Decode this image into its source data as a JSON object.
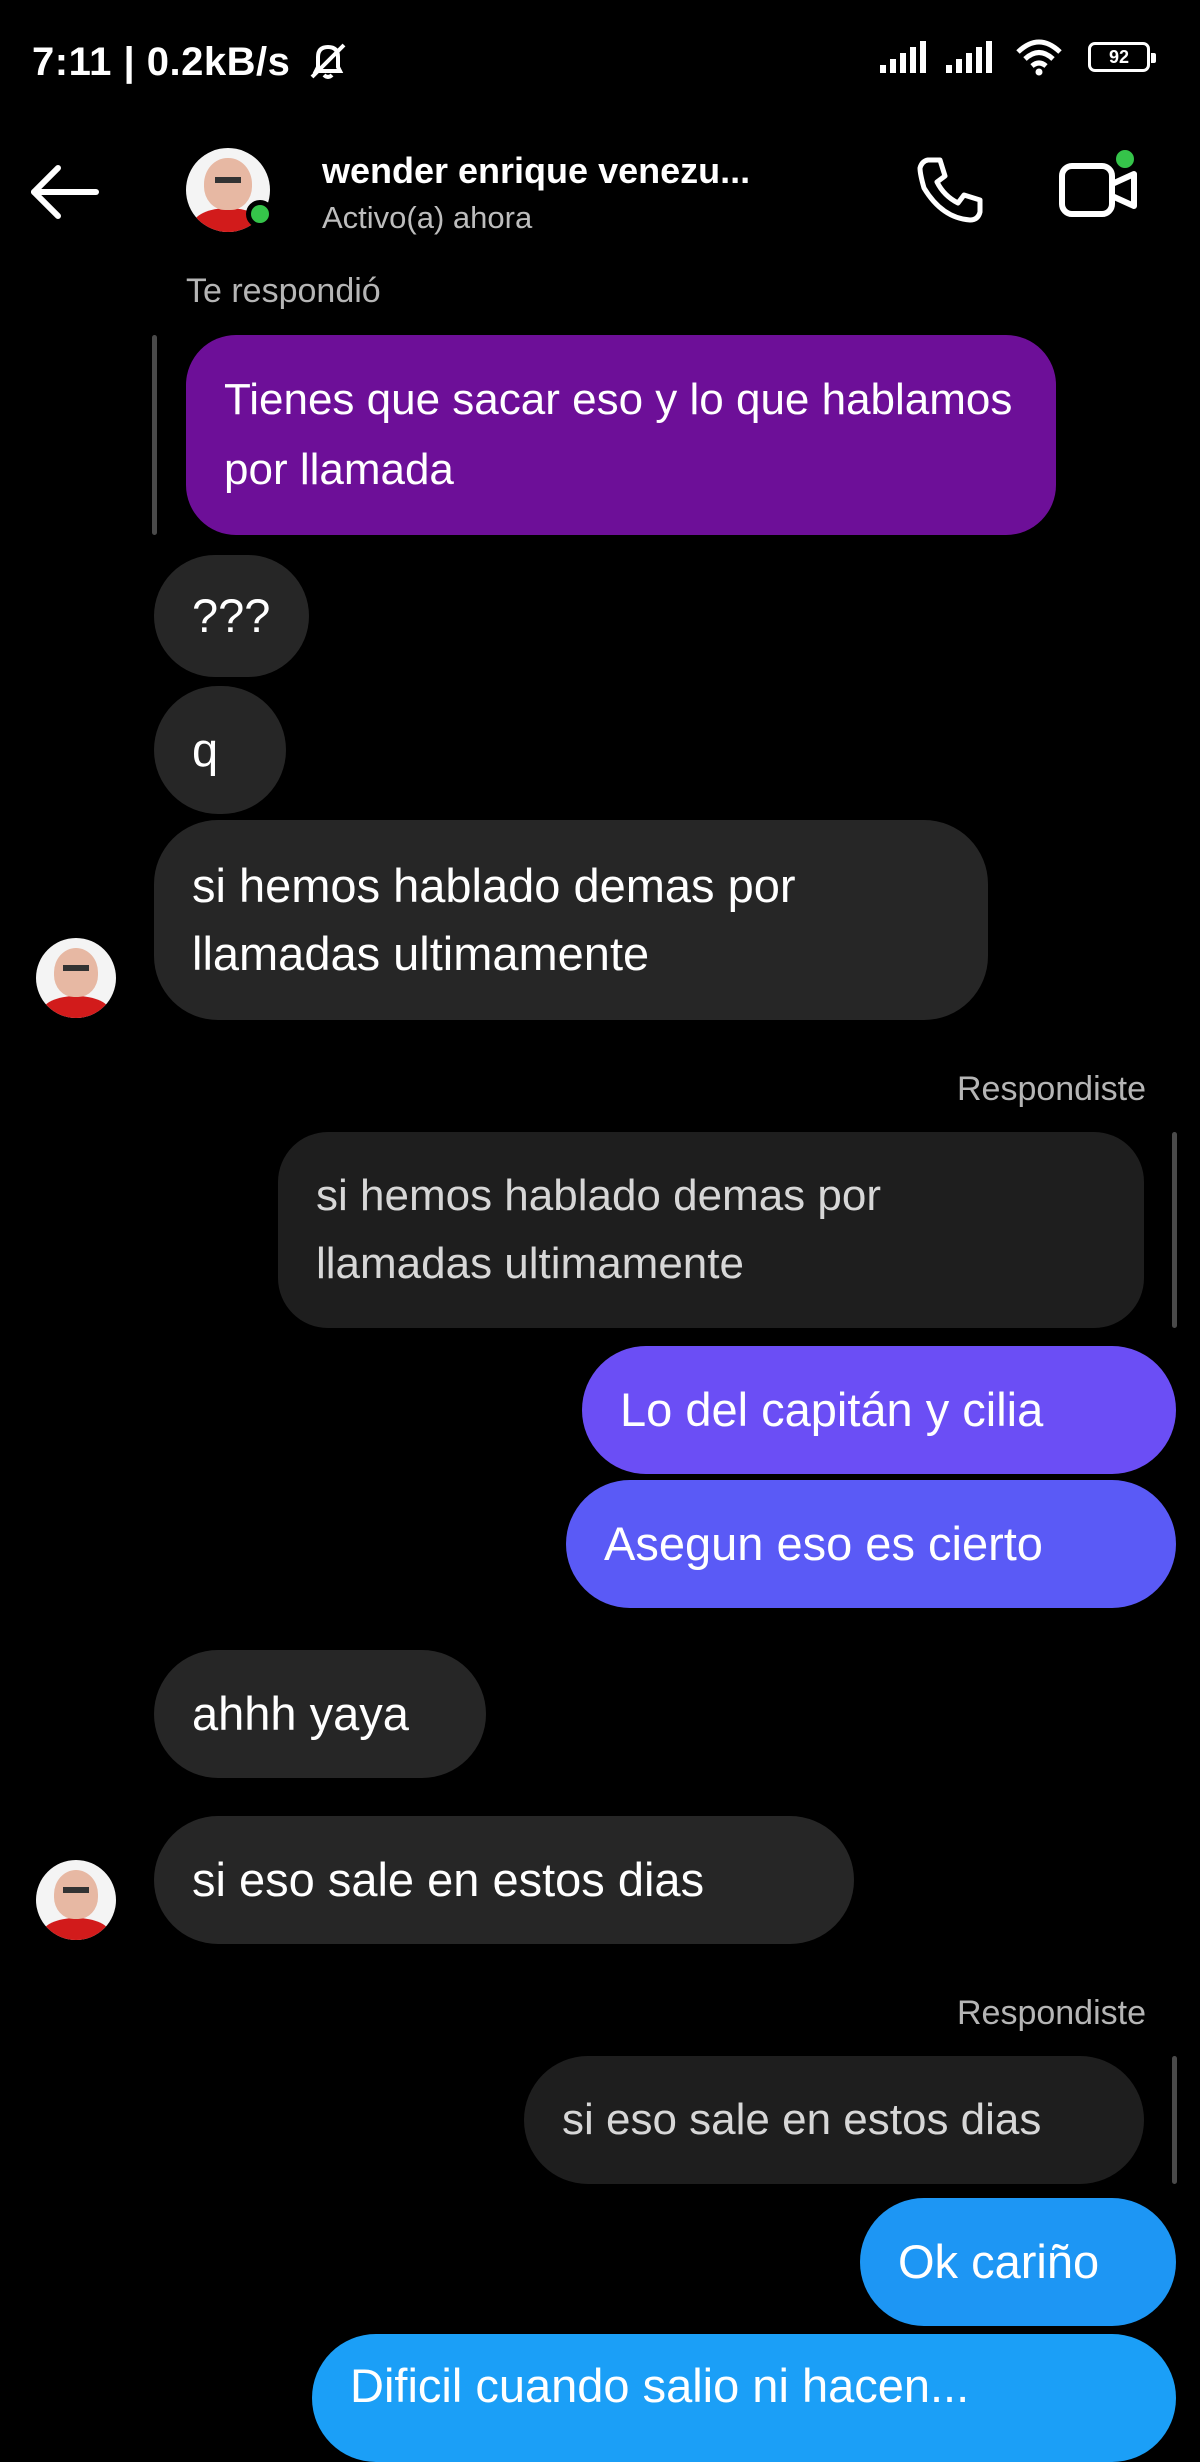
{
  "status_bar": {
    "time_speed": "7:11 | 0.2kB/s",
    "battery": "92"
  },
  "header": {
    "contact_name": "wender enrique venezu...",
    "status": "Activo(a) ahora"
  },
  "messages": {
    "reply_note_1": "Te respondió",
    "quoted_1": "Tienes que sacar eso y lo que hablamos por llamada",
    "m1": "???",
    "m2": "q",
    "m3_l1": "si hemos hablado demas por",
    "m3_l2": "llamadas ultimamente",
    "reply_note_2": "Respondiste",
    "quoted_2_l1": "si hemos hablado demas por",
    "quoted_2_l2": "llamadas ultimamente",
    "s1": "Lo del capitán y cilia",
    "s2": "Asegun eso es cierto",
    "m4": "ahhh yaya",
    "m5": "si eso sale en estos dias",
    "reply_note_3": "Respondiste",
    "quoted_3": "si eso sale en estos dias",
    "s3": "Ok cariño",
    "s4": "Dificil cuando salio ni hacen..."
  },
  "colors": {
    "background": "#000000",
    "incoming_bubble": "#262626",
    "purple_bubble": "#6d0f98",
    "sent_gradient_top": "#6a4cf4",
    "sent_gradient_bottom": "#1fa3f6",
    "online": "#35c44a"
  },
  "icons": [
    "mute-bell-icon",
    "signal-icon",
    "wifi-icon",
    "battery-icon",
    "back-arrow-icon",
    "phone-call-icon",
    "video-call-icon"
  ]
}
